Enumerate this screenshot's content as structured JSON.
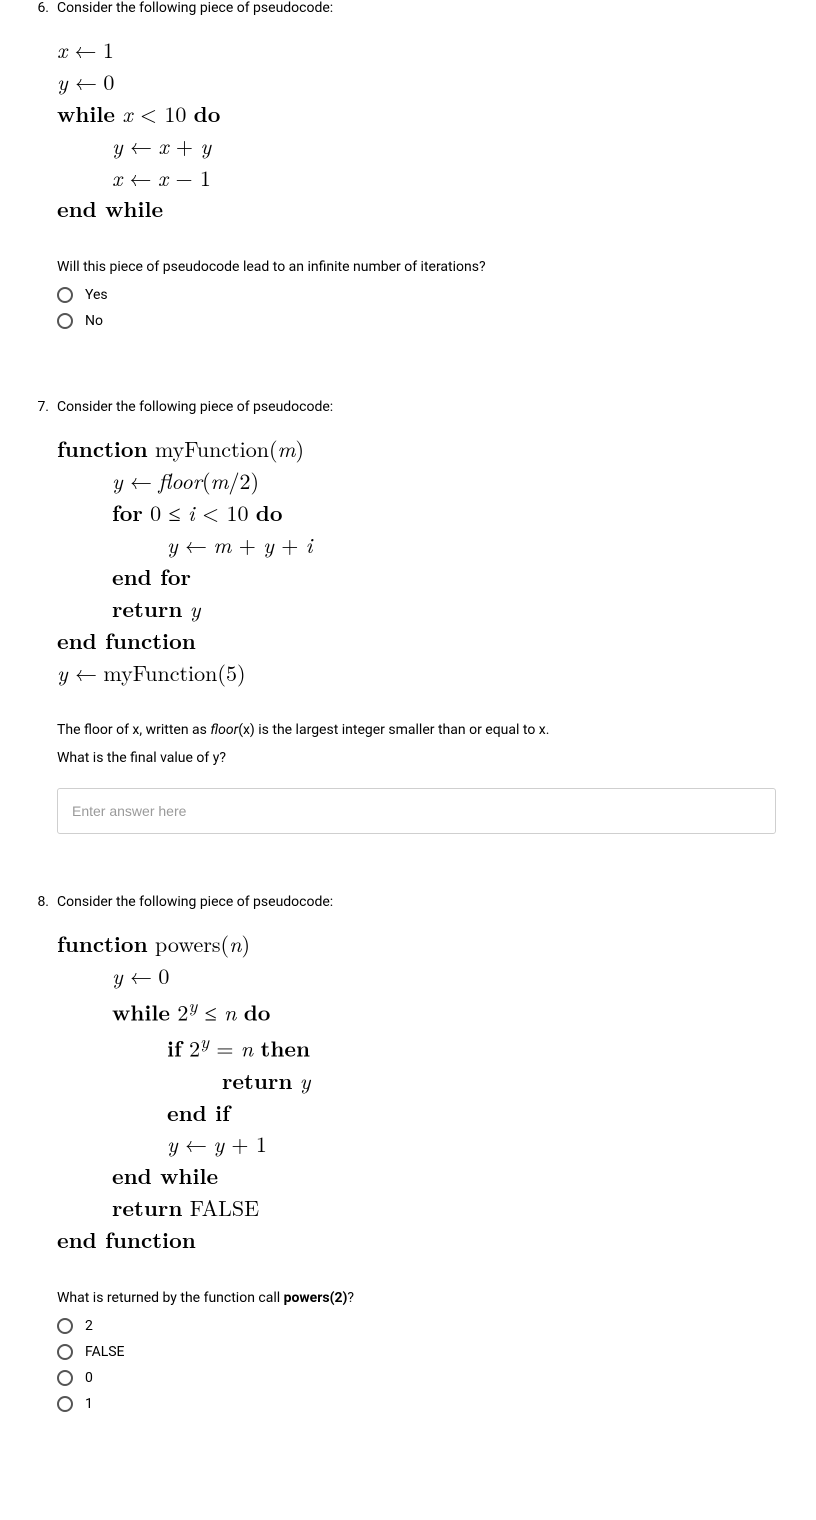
{
  "q6": {
    "number": "6.",
    "prompt": "Consider the following piece of pseudocode:",
    "code": {
      "l1_x": "x",
      "l1_v": "1",
      "l2_y": "y",
      "l2_v": "0",
      "l3_while": "while",
      "l3_cond_x": "x",
      "l3_cond_lt": "<",
      "l3_cond_10": "10",
      "l3_do": "do",
      "l4_y": "y",
      "l4_rhs_x": "x",
      "l4_plus": "+",
      "l4_rhs_y": "y",
      "l5_x": "x",
      "l5_rhs_x": "x",
      "l5_minus": "−",
      "l5_one": "1",
      "l6": "end while"
    },
    "sub": "Will this piece of pseudocode lead to an infinite number of iterations?",
    "opt1": "Yes",
    "opt2": "No"
  },
  "q7": {
    "number": "7.",
    "prompt": "Consider the following piece of pseudocode:",
    "code": {
      "fn": "function",
      "name": "myFunction",
      "arg": "m",
      "l2_y": "y",
      "l2_floor": "floor",
      "l2_m": "m",
      "l2_div2": "/2",
      "l3_for": "for",
      "l3_0": "0",
      "l3_le": "≤",
      "l3_i": "i",
      "l3_lt": "<",
      "l3_10": "10",
      "l3_do": "do",
      "l4_y": "y",
      "l4_m": "m",
      "l4_plus1": "+",
      "l4_y2": "y",
      "l4_plus2": "+",
      "l4_i": "i",
      "l5": "end for",
      "l6": "return",
      "l6_y": "y",
      "l7": "end function",
      "l8_y": "y",
      "l8_call": "myFunction",
      "l8_arg": "5"
    },
    "sub1_a": "The floor of x, written as ",
    "sub1_b": "floor",
    "sub1_c": "(x) is the largest integer smaller than or equal to x.",
    "sub2": "What is the final value of y?",
    "placeholder": "Enter answer here"
  },
  "q8": {
    "number": "8.",
    "prompt": "Consider the following piece of pseudocode:",
    "code": {
      "fn": "function",
      "name": "powers",
      "arg": "n",
      "l2_y": "y",
      "l2_0": "0",
      "l3_while": "while",
      "l3_2": "2",
      "l3_y": "y",
      "l3_le": "≤",
      "l3_n": "n",
      "l3_do": "do",
      "l4_if": "if",
      "l4_2": "2",
      "l4_y": "y",
      "l4_eq": "=",
      "l4_n": "n",
      "l4_then": "then",
      "l5_ret": "return",
      "l5_y": "y",
      "l6": "end if",
      "l7_y": "y",
      "l7_y2": "y",
      "l7_plus": "+",
      "l7_1": "1",
      "l8": "end while",
      "l9_ret": "return",
      "l9_false": "FALSE",
      "l10": "end function"
    },
    "sub_a": "What is returned by the function call ",
    "sub_b": "powers(2)",
    "sub_c": "?",
    "opt1": "2",
    "opt2": "FALSE",
    "opt3": "0",
    "opt4": "1"
  }
}
